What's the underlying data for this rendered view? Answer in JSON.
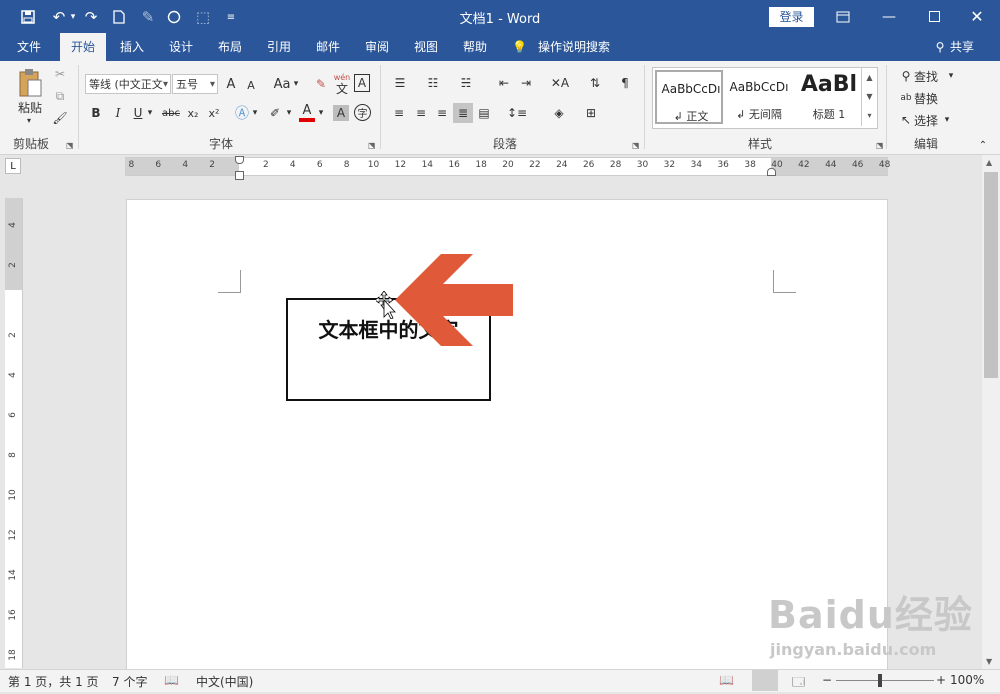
{
  "title_bar": {
    "document_title": "文档1  -  Word",
    "login_label": "登录",
    "icons": [
      "save-icon",
      "undo-icon",
      "redo-icon",
      "new-doc-icon",
      "touch-icon",
      "shape-icon",
      "pointer-icon",
      "customize-icon"
    ]
  },
  "tabs": [
    {
      "label": "文件"
    },
    {
      "label": "开始"
    },
    {
      "label": "插入"
    },
    {
      "label": "设计"
    },
    {
      "label": "布局"
    },
    {
      "label": "引用"
    },
    {
      "label": "邮件"
    },
    {
      "label": "审阅"
    },
    {
      "label": "视图"
    },
    {
      "label": "帮助"
    }
  ],
  "tell_me": "操作说明搜索",
  "share_label": "共享",
  "ribbon": {
    "clipboard": {
      "paste_label": "粘贴",
      "group_label": "剪贴板"
    },
    "font": {
      "font_name": "等线 (中文正文",
      "font_size": "五号",
      "grow": "A",
      "shrink": "A",
      "change_case": "Aa",
      "wen_label": "wén",
      "wen_char": "文",
      "border_char": "A",
      "bold": "B",
      "italic": "I",
      "underline": "U",
      "strike": "abc",
      "sub": "x₂",
      "sup": "x²",
      "font_color": "A",
      "shade_char": "A",
      "circle_char": "字",
      "group_label": "字体"
    },
    "paragraph": {
      "group_label": "段落"
    },
    "styles": {
      "items": [
        {
          "sample": "AaBbCcDı",
          "name": "↲ 正文"
        },
        {
          "sample": "AaBbCcDı",
          "name": "↲ 无间隔"
        },
        {
          "sample": "AaBl",
          "name": "标题 1"
        }
      ],
      "group_label": "样式"
    },
    "editing": {
      "find": "查找",
      "replace": "替换",
      "select": "选择",
      "group_label": "编辑"
    }
  },
  "ruler": {
    "h_numbers": [
      "8",
      "6",
      "4",
      "2",
      "2",
      "4",
      "6",
      "8",
      "10",
      "12",
      "14",
      "16",
      "18",
      "20",
      "22",
      "24",
      "26",
      "28",
      "30",
      "32",
      "34",
      "36",
      "38",
      "40",
      "42",
      "44",
      "46",
      "48"
    ],
    "v_numbers": [
      "4",
      "2",
      "2",
      "4",
      "6",
      "8",
      "10",
      "12",
      "14",
      "16",
      "18"
    ],
    "corner_label": "L"
  },
  "document": {
    "textbox_text": "文本框中的文字"
  },
  "status_bar": {
    "page_info": "第 1 页，共 1 页",
    "word_count": "7 个字",
    "language": "中文(中国)",
    "zoom": "100%"
  },
  "watermark": {
    "brand": "Baidu经验",
    "url": "jingyan.baidu.com"
  }
}
